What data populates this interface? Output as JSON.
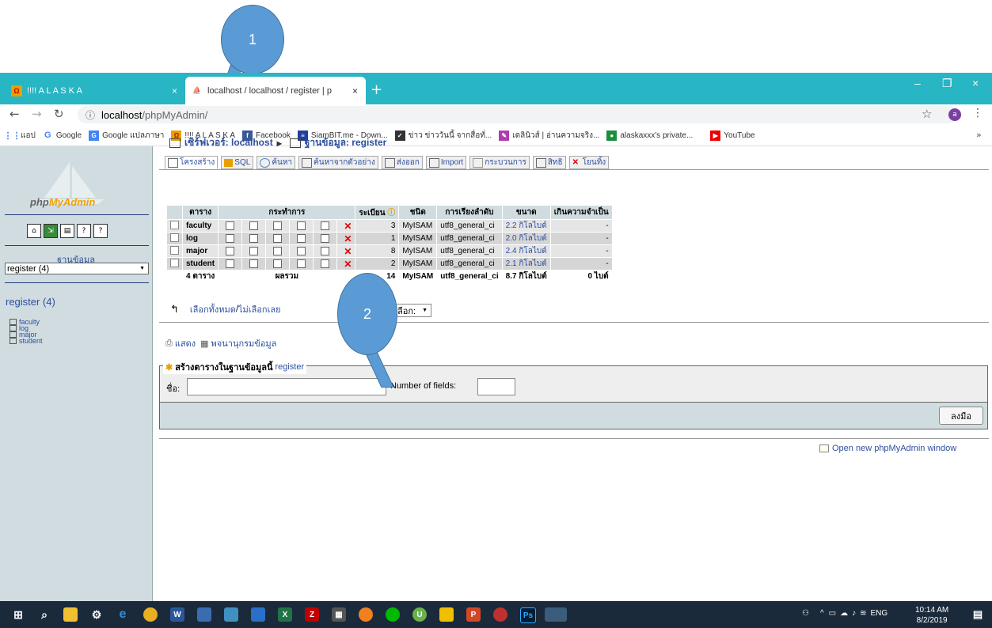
{
  "callouts": [
    "1",
    "2"
  ],
  "browser": {
    "tabs": [
      {
        "title": "!!!! A L A S K A",
        "close": "×"
      },
      {
        "title": "localhost / localhost / register | p",
        "close": "×"
      }
    ],
    "new_tab": "+",
    "window_controls": [
      "–",
      "❐",
      "×"
    ],
    "url_host": "localhost",
    "url_path": "/phpMyAdmin/",
    "profile_initial": "a",
    "bookmarks": [
      "แอป",
      "Google",
      "Google แปลภาษา",
      "!!!! A L A S K A",
      "Facebook",
      "SiamBIT.me - Down...",
      "ข่าว ข่าววันนี้ จากสื่อทั่...",
      "เดลินิวส์ | อ่านความจริง...",
      "alaskaxxx's private...",
      "YouTube"
    ],
    "bookmarks_more": "»"
  },
  "sidebar": {
    "logo_text_a": "php",
    "logo_text_b": "MyAdmin",
    "db_label": "ฐานข้อมูล",
    "db_select_value": "register (4)",
    "db_heading": "register (4)",
    "tables": [
      "faculty",
      "log",
      "major",
      "student"
    ]
  },
  "breadcrumb": {
    "server_label": "เซิร์ฟเวอร์: localhost",
    "arrow": "▸",
    "db_label": "ฐานข้อมูล: register"
  },
  "tabs": [
    "โครงสร้าง",
    "SQL",
    "ค้นหา",
    "ค้นหาจากตัวอย่าง",
    "ส่งออก",
    "Import",
    "กระบวนการ",
    "สิทธิ",
    "โยนทิ้ง"
  ],
  "table": {
    "headers": [
      "ตาราง",
      "กระทำการ",
      "ระเบียน",
      "ชนิด",
      "การเรียงลำดับ",
      "ขนาด",
      "เกินความจำเป็น"
    ],
    "rows": [
      {
        "name": "faculty",
        "records": "3",
        "type": "MyISAM",
        "collation": "utf8_general_ci",
        "size": "2.2 กิโลไบต์",
        "overhead": "-"
      },
      {
        "name": "log",
        "records": "1",
        "type": "MyISAM",
        "collation": "utf8_general_ci",
        "size": "2.0 กิโลไบต์",
        "overhead": "-"
      },
      {
        "name": "major",
        "records": "8",
        "type": "MyISAM",
        "collation": "utf8_general_ci",
        "size": "2.4 กิโลไบต์",
        "overhead": "-"
      },
      {
        "name": "student",
        "records": "2",
        "type": "MyISAM",
        "collation": "utf8_general_ci",
        "size": "2.1 กิโลไบต์",
        "overhead": "-"
      }
    ],
    "footer": {
      "count": "4 ตาราง",
      "sum_label": "ผลรวม",
      "records": "14",
      "type": "MyISAM",
      "collation": "utf8_general_ci",
      "size": "8.7 กิโลไบต์",
      "overhead": "0 ไบต์"
    }
  },
  "check_all": "เลือกทั้งหมด",
  "check_sep": " / ",
  "uncheck_all": "ไม่เลือกเลย",
  "with_selected": "ลือก:",
  "print_view": "แสดง",
  "data_dictionary": "พจนานุกรมข้อมูล",
  "create_table": {
    "legend": "สร้างตารางในฐานข้อมูลนี้",
    "legend_db": "register",
    "name_label": "ชื่อ:",
    "fields_label": "Number of fields:",
    "go_button": "ลงมือ"
  },
  "new_window_link": "Open new phpMyAdmin window",
  "taskbar": {
    "tray_lang": "ENG",
    "time": "10:14 AM",
    "date": "8/2/2019"
  }
}
